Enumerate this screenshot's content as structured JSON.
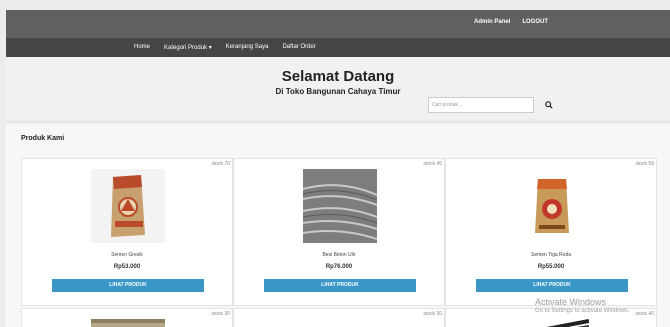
{
  "topbar": {
    "admin_panel": "Admin Panel",
    "logout": "LOGOUT"
  },
  "nav": {
    "home": "Home",
    "kategori": "Kategori Produk",
    "keranjang": "Keranjang Saya",
    "order": "Daftar Order"
  },
  "hero": {
    "title": "Selamat Datang",
    "subtitle": "Di Toko Bangunan Cahaya Timur",
    "search_placeholder": "Cari produk...",
    "search_icon": "search-icon"
  },
  "section": {
    "title": "Produk Kami"
  },
  "products": [
    {
      "stock": "stock 70",
      "name": "Semen Gresik",
      "price": "Rp53.000",
      "button": "LIHAT PRODUK"
    },
    {
      "stock": "stock 45",
      "name": "Besi Beton Ulir",
      "price": "Rp76.000",
      "button": "LIHAT PRODUK"
    },
    {
      "stock": "stock 59",
      "name": "Semen Tiga Roda",
      "price": "Rp55.000",
      "button": "LIHAT PRODUK"
    },
    {
      "stock": "stock 30"
    },
    {
      "stock": "stock 30"
    },
    {
      "stock": "stock 40"
    }
  ],
  "watermark": {
    "line1": "Activate Windows",
    "line2": "Go to Settings to activate Windows."
  },
  "colors": {
    "button": "#3b97c8",
    "topbar": "#5f6062",
    "navbar": "#454648"
  }
}
